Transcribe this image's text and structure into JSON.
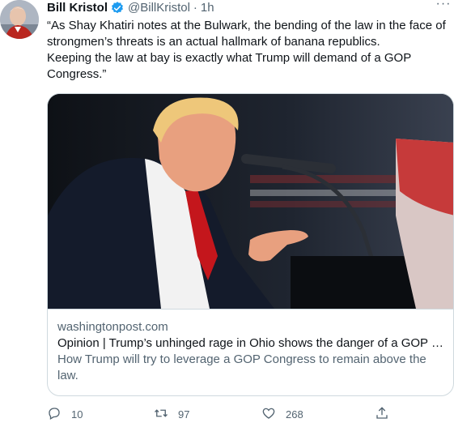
{
  "tweet": {
    "author_name": "Bill Kristol",
    "handle": "@BillKristol",
    "separator": "·",
    "time": "1h",
    "more_label": "···",
    "text_line1": "“As Shay Khatiri notes at the Bulwark, the bending of the law in the face of strongmen’s threats is an actual hallmark of banana republics.",
    "text_line2": "Keeping the law at bay is exactly what Trump will demand of a GOP Congress.”"
  },
  "card": {
    "domain": "washingtonpost.com",
    "title": "Opinion | Trump’s unhinged rage in Ohio shows the danger of a GOP C...",
    "description": "How Trump will try to leverage a GOP Congress to remain above the law."
  },
  "actions": {
    "reply_count": "10",
    "retweet_count": "97",
    "like_count": "268"
  },
  "colors": {
    "text_primary": "#0f1419",
    "text_secondary": "#536471",
    "verified_blue": "#1d9bf0",
    "border": "#cfd9de"
  },
  "icons": {
    "verified": "verified-badge-icon",
    "more": "more-icon",
    "reply": "reply-icon",
    "retweet": "retweet-icon",
    "like": "like-icon",
    "share": "share-icon"
  }
}
